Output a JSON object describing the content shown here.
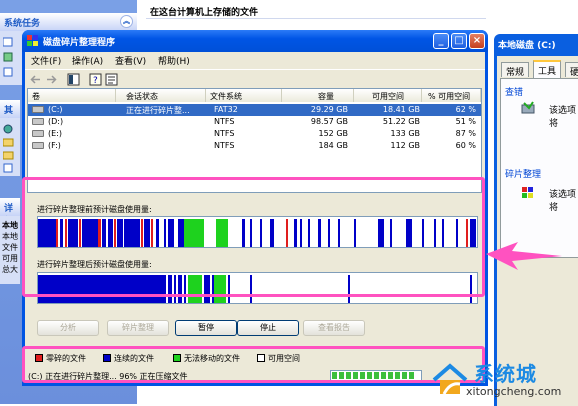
{
  "explorer": {
    "section_heading": "在这台计算机上存储的文件",
    "task_groups": [
      {
        "title": "系统任务"
      },
      {
        "title": "其它"
      },
      {
        "title": "详细"
      }
    ],
    "details_lines": [
      "本地",
      "本地",
      "文件",
      "可用",
      "总大"
    ]
  },
  "properties_window": {
    "title": "本地磁盘 (C:)",
    "tabs": [
      "常规",
      "工具",
      "硬"
    ],
    "active_tab": "工具",
    "groups": [
      {
        "title": "查错",
        "text": "该选项将"
      },
      {
        "title": "碎片整理",
        "text": "该选项将"
      }
    ]
  },
  "window": {
    "title": "磁盘碎片整理程序",
    "buttons": {
      "minimize": "_",
      "maximize": "□",
      "close": "×"
    }
  },
  "menu": [
    "文件(F)",
    "操作(A)",
    "查看(V)",
    "帮助(H)"
  ],
  "toolbar_icons": [
    "back-arrow-icon",
    "forward-arrow-icon",
    "volume-list-icon",
    "help-icon",
    "properties-icon"
  ],
  "volumes": {
    "columns": [
      "卷",
      "会话状态",
      "文件系统",
      "容量",
      "可用空间",
      "% 可用空间"
    ],
    "rows": [
      {
        "volume": "(C:)",
        "status": "正在进行碎片整...",
        "fs": "FAT32",
        "capacity": "29.29 GB",
        "free": "18.41 GB",
        "pct": "62 %",
        "selected": true
      },
      {
        "volume": "(D:)",
        "status": "",
        "fs": "NTFS",
        "capacity": "98.57 GB",
        "free": "51.22 GB",
        "pct": "51 %",
        "selected": false
      },
      {
        "volume": "(E:)",
        "status": "",
        "fs": "NTFS",
        "capacity": "152 GB",
        "free": "133 GB",
        "pct": "87 %",
        "selected": false
      },
      {
        "volume": "(F:)",
        "status": "",
        "fs": "NTFS",
        "capacity": "184 GB",
        "free": "112 GB",
        "pct": "60 %",
        "selected": false
      }
    ]
  },
  "analysis": {
    "before_label": "进行碎片整理前预计磁盘使用量:",
    "after_label": "进行碎片整理后预计磁盘使用量:"
  },
  "actions": [
    {
      "label": "分析",
      "enabled": false
    },
    {
      "label": "碎片整理",
      "enabled": false
    },
    {
      "label": "暂停",
      "enabled": true
    },
    {
      "label": "停止",
      "enabled": true
    },
    {
      "label": "查看报告",
      "enabled": false
    }
  ],
  "legend": [
    {
      "label": "零碎的文件",
      "color": "#e01e1e"
    },
    {
      "label": "连续的文件",
      "color": "#0000c8"
    },
    {
      "label": "无法移动的文件",
      "color": "#1ed21e"
    },
    {
      "label": "可用空间",
      "color": "#ffffff"
    }
  ],
  "status": {
    "text": "(C:) 正在进行碎片整理...  96%  正在压缩文件",
    "progress": 0.96
  },
  "colors": {
    "fragmented": "#e01e1e",
    "contiguous": "#0000c8",
    "unmovable": "#1ed21e",
    "free": "#ffffff",
    "annotation": "#ff52c0"
  },
  "watermark": {
    "title": "系统城",
    "url": "xitongcheng.com"
  }
}
